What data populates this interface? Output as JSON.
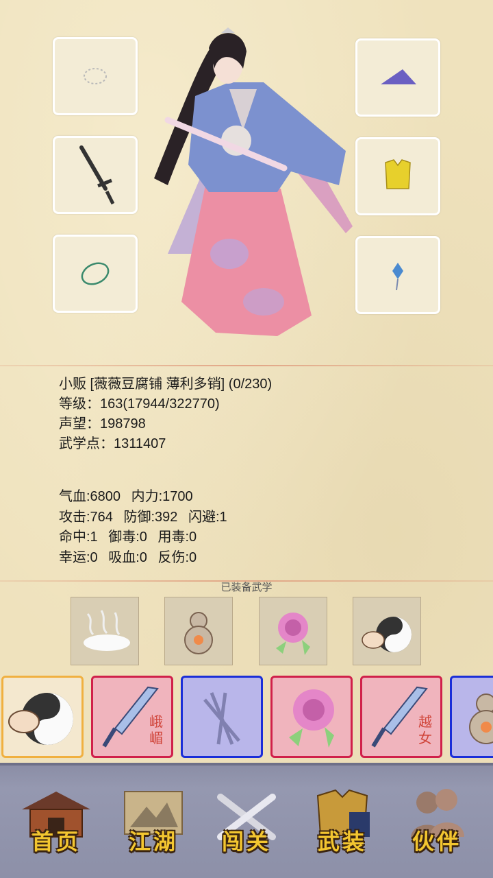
{
  "equipment_slots": {
    "left": [
      {
        "name": "necklace-slot",
        "icon": "necklace-icon"
      },
      {
        "name": "weapon-slot",
        "icon": "sword-icon"
      },
      {
        "name": "bracelet-slot",
        "icon": "bracelet-icon"
      }
    ],
    "right": [
      {
        "name": "hat-slot",
        "icon": "hat-icon"
      },
      {
        "name": "armor-slot",
        "icon": "vest-icon"
      },
      {
        "name": "accessory-slot",
        "icon": "pendant-icon"
      }
    ]
  },
  "character": {
    "title_line": "小贩 [薇薇豆腐铺 薄利多销] (0/230)",
    "level_line": "等级：163(17944/322770)",
    "reputation_line": "声望：198798",
    "martial_points_line": "武学点：1311407"
  },
  "stats": {
    "row1": [
      "气血:6800",
      "内力:1700"
    ],
    "row2": [
      "攻击:764",
      "防御:392",
      "闪避:1"
    ],
    "row3": [
      "命中:1",
      "御毒:0",
      "用毒:0"
    ],
    "row4": [
      "幸运:0",
      "吸血:0",
      "反伤:0"
    ]
  },
  "equipped_martial": {
    "label": "已装备武学",
    "skills": [
      "mist-icon",
      "gourd-icon",
      "rose-icon",
      "yin-yang-fist-icon"
    ]
  },
  "skill_cards": [
    {
      "style": "gold",
      "icon": "yin-yang-fist-icon",
      "tag": ""
    },
    {
      "style": "pink",
      "icon": "sword-icon",
      "tag": "峨嵋"
    },
    {
      "style": "blue",
      "icon": "bamboo-icon",
      "tag": ""
    },
    {
      "style": "pink",
      "icon": "rose-icon",
      "tag": ""
    },
    {
      "style": "pink",
      "icon": "sword-icon",
      "tag": "越女"
    },
    {
      "style": "blue",
      "icon": "gourd-icon",
      "tag": ""
    }
  ],
  "nav": {
    "home": "首页",
    "jianghu": "江湖",
    "chuangguan": "闯关",
    "wuzhuang": "武装",
    "huoban": "伙伴"
  },
  "colors": {
    "paper": "#efe2bd",
    "pink_border": "#d0204a",
    "blue_border": "#1a2ed8",
    "gold_border": "#f0b040",
    "nav_text": "#f3c630"
  }
}
